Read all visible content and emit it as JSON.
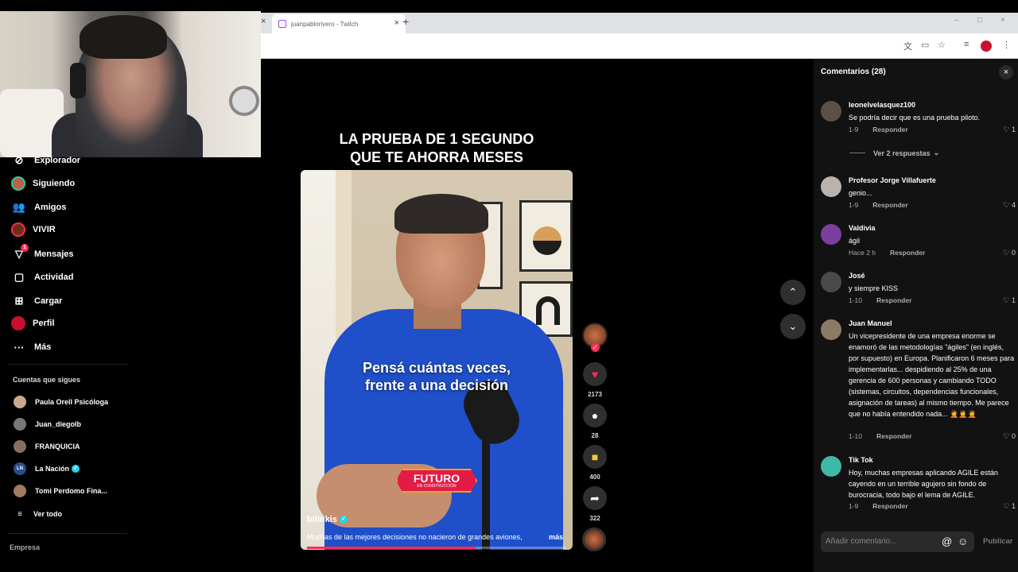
{
  "browser": {
    "tab_title": "juanpablorivero - Twitch",
    "tab_close": "×",
    "new_tab": "+",
    "window_controls": [
      "–",
      "□",
      "×"
    ],
    "toolbar_icons": [
      "translate-icon",
      "cast-icon",
      "star-icon",
      "reading-list-icon",
      "profile-icon",
      "kebab-icon"
    ]
  },
  "sidebar": {
    "nav": [
      {
        "label": "Explorador",
        "icon": "compass-icon"
      },
      {
        "label": "Siguiendo",
        "icon": "following-avatar-icon"
      },
      {
        "label": "Amigos",
        "icon": "friends-icon"
      },
      {
        "label": "VIVIR",
        "icon": "live-avatar-icon"
      },
      {
        "label": "Mensajes",
        "icon": "messages-icon",
        "badge": "1"
      },
      {
        "label": "Actividad",
        "icon": "activity-icon"
      },
      {
        "label": "Cargar",
        "icon": "upload-icon"
      },
      {
        "label": "Perfil",
        "icon": "profile-icon"
      },
      {
        "label": "Más",
        "icon": "more-icon"
      }
    ],
    "following_title": "Cuentas que sigues",
    "following": [
      {
        "name": "Paula Orell Psicóloga"
      },
      {
        "name": "Juan_diegolb"
      },
      {
        "name": "FRANQUICIA"
      },
      {
        "name": "La Nación",
        "verified": true,
        "avatar_text": "LN"
      },
      {
        "name": "Tomi Perdomo Fina..."
      }
    ],
    "see_all": "Ver todo",
    "company": "Empresa"
  },
  "video": {
    "headline_1": "LA PRUEBA DE 1 SEGUNDO",
    "headline_2": "QUE TE AHORRA MESES",
    "subtitle_1": "Pensá cuántas veces,",
    "subtitle_2": "frente a una decisión",
    "badge_main": "FUTURO",
    "badge_sub": "EN CONSTRUCCIÓN",
    "author": "bilinkis",
    "caption": "Muchas de las mejores decisiones no nacieron de grandes aviones,",
    "more": "más",
    "progress": 0.65
  },
  "actions": {
    "likes": "2173",
    "comments": "28",
    "saves": "400",
    "shares": "322"
  },
  "comments": {
    "header": "Comentarios  (28)",
    "close": "×",
    "respond": "Responder",
    "items": [
      {
        "user": "leonelvelasquez100",
        "text": "Se podría decir que es una prueba piloto.",
        "date": "1-9",
        "likes": "1"
      },
      {
        "user": "Profesor Jorge Villafuerte",
        "text": "genio...",
        "date": "1-9",
        "likes": "4"
      },
      {
        "user": "Valdivia",
        "text": "ágil",
        "date": "Hace 2 h",
        "likes": "0"
      },
      {
        "user": "José",
        "text": "y siempre KISS",
        "date": "1-10",
        "likes": "1"
      },
      {
        "user": "Juan Manuel",
        "text": "Un vicepresidente de una empresa enorme se enamoró de las metodologías \"ágiles\" (en inglés, por supuesto) en Europa. Planificaron 6 meses para implementarlas... despidiendo al 25% de una gerencia de 600 personas y cambiando TODO (sistemas, circuitos, dependencias funcionales, asignación de tareas) al mismo tiempo. Me parece que no había entendido nada... 🤦🤦🤦",
        "date": "1-10",
        "likes": "0"
      },
      {
        "user": "Tik Tok",
        "text": "Hoy, muchas empresas aplicando AGILE están cayendo en un terrible agujero sin fondo de burocracia, todo bajo el lema de AGILE.",
        "date": "1-9",
        "likes": "1"
      }
    ],
    "replies_label": "Ver 2 respuestas",
    "input_placeholder": "Añadir comentario...",
    "publish": "Publicar"
  }
}
